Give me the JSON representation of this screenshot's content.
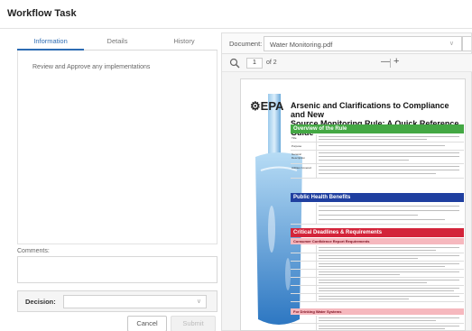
{
  "app": {
    "title": "Workflow Task"
  },
  "tabs": [
    {
      "label": "Information",
      "active": true
    },
    {
      "label": "Details",
      "active": false
    },
    {
      "label": "History",
      "active": false
    }
  ],
  "info": {
    "text": "Review and Approve any implementations"
  },
  "comments": {
    "label": "Comments:",
    "value": ""
  },
  "decision": {
    "label": "Decision:",
    "value": ""
  },
  "buttons": {
    "cancel": "Cancel",
    "submit": "Submit"
  },
  "document": {
    "label": "Document:",
    "selected": "Water Monitoring.pdf",
    "toolbar": {
      "page": "1",
      "of_label": "of 2",
      "zoom_out": "—",
      "zoom_in": "+"
    }
  },
  "pdf_preview": {
    "agency": "EPA",
    "title_line1": "Arsenic and Clarifications to Compliance and New",
    "title_line2": "Source Monitoring Rule:  A Quick Reference Guide",
    "section1": "Overview of the Rule",
    "section2": "Public Health Benefits",
    "section3": "Critical Deadlines & Requirements",
    "sub1": "Consumer Confidence Report Requirements",
    "sub2": "For Drinking Water Systems",
    "row_labels": [
      "Title",
      "Purpose",
      "General Description",
      "Utilities Covered"
    ]
  },
  "colors": {
    "accent": "#2c6bb3",
    "green_band": "#44a844",
    "blue_band": "#1f3fa0",
    "red_band": "#d3243a"
  }
}
